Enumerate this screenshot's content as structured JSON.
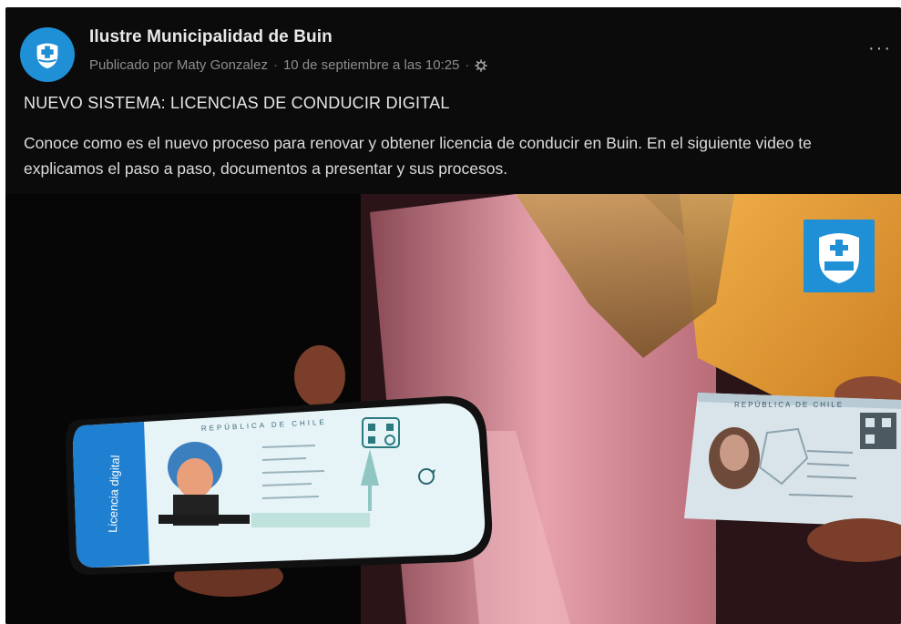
{
  "post": {
    "page_name": "Ilustre Municipalidad de Buin",
    "published_by": "Publicado por Maty Gonzalez",
    "date": "10 de septiembre a las 10:25",
    "separator": "·",
    "more_label": "···",
    "title": "NUEVO SISTEMA: LICENCIAS DE CONDUCIR DIGITAL",
    "body": "Conoce como es el nuevo proceso para renovar y obtener licencia de conducir en Buin. En el siguiente video te explicamos el paso a paso, documentos a presentar y sus procesos."
  },
  "media": {
    "phone_sidebar_text": "Licencia digital",
    "phone_card_header": "REPÚBLICA DE CHILE",
    "physical_card_header": "REPÚBLICA DE CHILE",
    "icons": [
      "municipal-logo-icon",
      "qr-code-icon",
      "refresh-icon",
      "gear-icon"
    ]
  },
  "colors": {
    "background": "#0b0b0b",
    "brand_blue": "#1f8fd6",
    "text_primary": "#e6e6e6",
    "text_secondary": "#8d8d8d"
  }
}
